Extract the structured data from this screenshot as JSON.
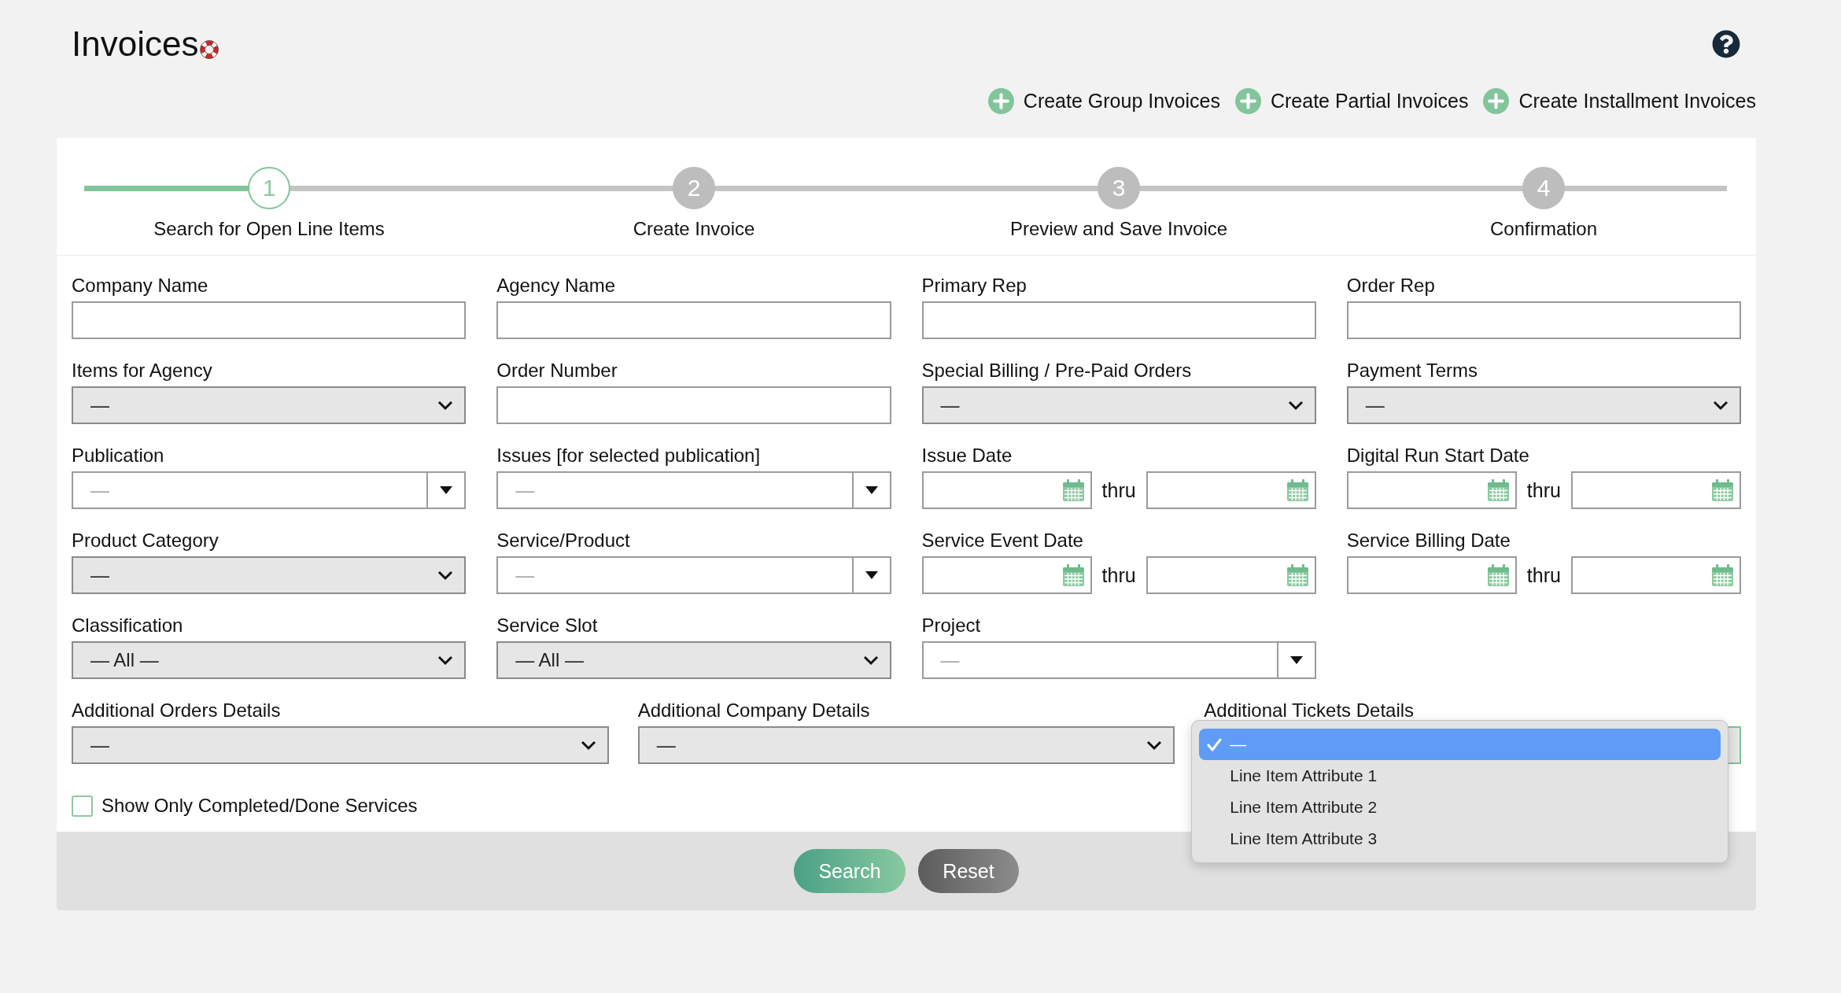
{
  "page": {
    "title": "Invoices"
  },
  "actions": [
    {
      "label": "Create Group Invoices"
    },
    {
      "label": "Create Partial Invoices"
    },
    {
      "label": "Create Installment Invoices"
    }
  ],
  "steps": [
    {
      "number": "1",
      "label": "Search for Open Line Items",
      "selected": true
    },
    {
      "number": "2",
      "label": "Create Invoice",
      "selected": false
    },
    {
      "number": "3",
      "label": "Preview and Save Invoice",
      "selected": false
    },
    {
      "number": "4",
      "label": "Confirmation",
      "selected": false
    }
  ],
  "fields": [
    {
      "kind": "text",
      "label": "Company Name"
    },
    {
      "kind": "text",
      "label": "Agency Name"
    },
    {
      "kind": "text",
      "label": "Primary Rep"
    },
    {
      "kind": "text",
      "label": "Order Rep"
    },
    {
      "kind": "select",
      "label": "Items for Agency",
      "value": "—"
    },
    {
      "kind": "text",
      "label": "Order Number"
    },
    {
      "kind": "select",
      "label": "Special Billing / Pre-Paid Orders",
      "value": "—"
    },
    {
      "kind": "select",
      "label": "Payment Terms",
      "value": "—"
    },
    {
      "kind": "combo",
      "label": "Publication",
      "value": "—"
    },
    {
      "kind": "combo",
      "label": "Issues [for selected publication]",
      "value": "—"
    },
    {
      "kind": "date_range",
      "label": "Issue Date",
      "separator": "thru"
    },
    {
      "kind": "date_range",
      "label": "Digital Run Start Date",
      "separator": "thru"
    },
    {
      "kind": "select",
      "label": "Product Category",
      "value": "—"
    },
    {
      "kind": "combo",
      "label": "Service/Product",
      "value": "—"
    },
    {
      "kind": "date_range",
      "label": "Service Event Date",
      "separator": "thru"
    },
    {
      "kind": "date_range",
      "label": "Service Billing Date",
      "separator": "thru"
    },
    {
      "kind": "select",
      "label": "Classification",
      "value": "— All —"
    },
    {
      "kind": "select",
      "label": "Service Slot",
      "value": "— All —"
    },
    {
      "kind": "combo",
      "label": "Project",
      "value": "—"
    }
  ],
  "additional_fields": [
    {
      "kind": "select",
      "label": "Additional Orders Details",
      "value": "—"
    },
    {
      "kind": "select",
      "label": "Additional Company Details",
      "value": "—"
    },
    {
      "kind": "select",
      "label": "Additional Tickets Details",
      "open": true,
      "options": [
        {
          "label": "—",
          "selected": true
        },
        {
          "label": "Line Item Attribute 1",
          "selected": false
        },
        {
          "label": "Line Item Attribute 2",
          "selected": false
        },
        {
          "label": "Line Item Attribute 3",
          "selected": false
        }
      ]
    }
  ],
  "checkbox": {
    "label": "Show Only Completed/Done Services",
    "checked": false
  },
  "buttons": [
    {
      "label": "Search",
      "kind": "primary"
    },
    {
      "label": "Reset",
      "kind": "secondary"
    }
  ]
}
